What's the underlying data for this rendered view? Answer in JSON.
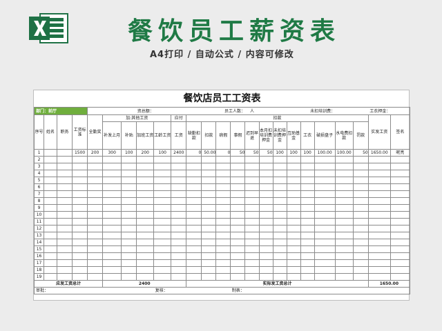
{
  "banner": {
    "title": "餐饮员工薪资表",
    "subtitle": "A4打印 / 自动公式 / 内容可修改",
    "icon": "excel-logo-icon",
    "title_color": "#1f7a45",
    "icon_color": "#1e7145"
  },
  "sheet": {
    "title": "餐饮店员工工资表",
    "dept_label": "部门：前厅",
    "info": {
      "total_label": "资总额：",
      "staff_label": "员工人数：",
      "staff_unit": "人",
      "training_label": "未扣培训费：",
      "deposit_label": "工衣押金："
    },
    "header": {
      "seq": "序号",
      "name": "姓名",
      "position": "职务",
      "salary_std": "工资标准",
      "attendance": "全勤奖",
      "add_group": "加:其他工资",
      "add_back": "补发上月",
      "subsidy": "补贴",
      "overtime": "加班工资",
      "seniority": "工龄工资",
      "payable_group": "应付",
      "wage": "工资",
      "deduct_group": "扣款",
      "absence": "缺勤扣款",
      "deduction": "扣款",
      "sick": "病假",
      "personal": "事假",
      "late": "迟到早退",
      "training_month": "本月扣培训费押金",
      "training_unpaid": "未扣培训费押金",
      "mutual": "互助基金",
      "uniform": "工衣",
      "broken": "破损盘子",
      "utility": "水电费扣款",
      "fine": "罚款",
      "net": "实发工资",
      "sign": "签名"
    },
    "rows": [
      {
        "seq": "1",
        "name": "",
        "position": "",
        "salary_std": "1500",
        "attendance": "200",
        "add_back": "300",
        "subsidy": "100",
        "overtime": "200",
        "seniority": "100",
        "wage": "2400",
        "absence": "0",
        "deduction": "50.00",
        "sick": "0",
        "personal": "50",
        "late": "50",
        "training_month": "50",
        "training_unpaid": "100",
        "mutual": "100",
        "uniform": "100",
        "broken": "100.00",
        "utility": "100.00",
        "fine": "50",
        "net": "1650.00",
        "sign": "昵亮"
      },
      {
        "seq": "2"
      },
      {
        "seq": "3"
      },
      {
        "seq": "4"
      },
      {
        "seq": "5"
      },
      {
        "seq": "6"
      },
      {
        "seq": "7"
      },
      {
        "seq": "8"
      },
      {
        "seq": "9"
      },
      {
        "seq": "10"
      },
      {
        "seq": "11"
      },
      {
        "seq": "12"
      },
      {
        "seq": "13"
      },
      {
        "seq": "14"
      },
      {
        "seq": "15"
      },
      {
        "seq": "16"
      },
      {
        "seq": "17"
      },
      {
        "seq": "18"
      },
      {
        "seq": "19"
      }
    ],
    "totals": {
      "payable_label": "应发工资总计",
      "payable_value": "2400",
      "net_label": "实际发工资总计",
      "net_value": "1650.00"
    },
    "footer": {
      "approve": "审批：",
      "review": "复核：",
      "prepared": "制表："
    },
    "dept_color": "#6fae3d"
  }
}
